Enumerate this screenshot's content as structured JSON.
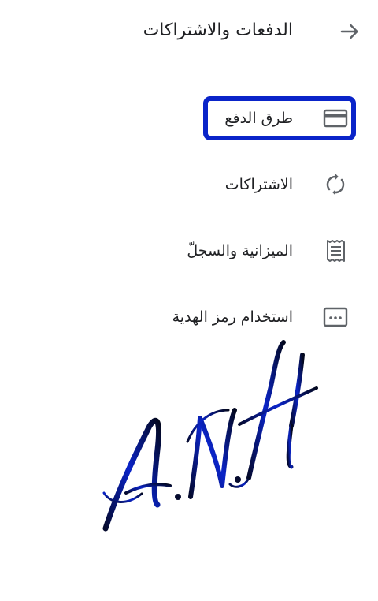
{
  "header": {
    "title": "الدفعات والاشتراكات",
    "back_icon": "arrow-right-icon"
  },
  "menu": {
    "items": [
      {
        "label": "طرق الدفع",
        "icon": "credit-card-icon",
        "selected": true
      },
      {
        "label": "الاشتراكات",
        "icon": "sync-icon"
      },
      {
        "label": "الميزانية والسجلّ",
        "icon": "receipt-icon"
      },
      {
        "label": "استخدام رمز الهدية",
        "icon": "gift-code-icon"
      }
    ]
  },
  "watermark": {
    "text": "A.N.H"
  },
  "colors": {
    "highlight": "#0a24c9",
    "icon": "#5f6368",
    "text": "#202124"
  }
}
